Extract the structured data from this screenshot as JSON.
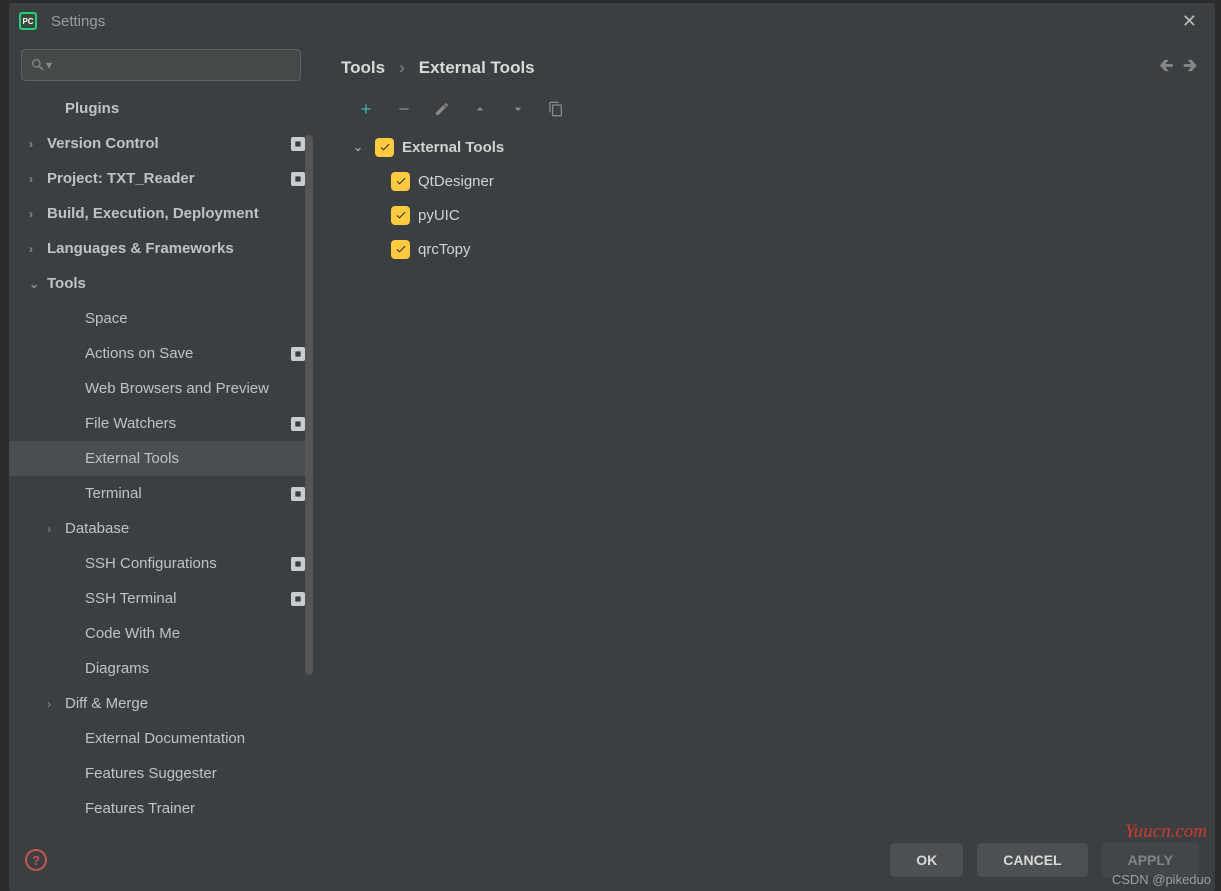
{
  "window": {
    "title": "Settings"
  },
  "search": {
    "placeholder": ""
  },
  "sidebar": {
    "items": [
      {
        "label": "Plugins",
        "arrow": "",
        "badge": false,
        "indent": 1,
        "bold": true
      },
      {
        "label": "Version Control",
        "arrow": "›",
        "badge": true,
        "indent": 0,
        "bold": true
      },
      {
        "label": "Project: TXT_Reader",
        "arrow": "›",
        "badge": true,
        "indent": 0,
        "bold": true
      },
      {
        "label": "Build, Execution, Deployment",
        "arrow": "›",
        "badge": false,
        "indent": 0,
        "bold": true
      },
      {
        "label": "Languages & Frameworks",
        "arrow": "›",
        "badge": false,
        "indent": 0,
        "bold": true
      },
      {
        "label": "Tools",
        "arrow": "⌄",
        "badge": false,
        "indent": 0,
        "bold": true
      },
      {
        "label": "Space",
        "arrow": "",
        "badge": false,
        "indent": 2,
        "bold": false
      },
      {
        "label": "Actions on Save",
        "arrow": "",
        "badge": true,
        "indent": 2,
        "bold": false
      },
      {
        "label": "Web Browsers and Preview",
        "arrow": "",
        "badge": false,
        "indent": 2,
        "bold": false
      },
      {
        "label": "File Watchers",
        "arrow": "",
        "badge": true,
        "indent": 2,
        "bold": false
      },
      {
        "label": "External Tools",
        "arrow": "",
        "badge": false,
        "indent": 2,
        "bold": false,
        "selected": true
      },
      {
        "label": "Terminal",
        "arrow": "",
        "badge": true,
        "indent": 2,
        "bold": false
      },
      {
        "label": "Database",
        "arrow": "›",
        "badge": false,
        "indent": 1,
        "bold": false
      },
      {
        "label": "SSH Configurations",
        "arrow": "",
        "badge": true,
        "indent": 2,
        "bold": false
      },
      {
        "label": "SSH Terminal",
        "arrow": "",
        "badge": true,
        "indent": 2,
        "bold": false
      },
      {
        "label": "Code With Me",
        "arrow": "",
        "badge": false,
        "indent": 2,
        "bold": false
      },
      {
        "label": "Diagrams",
        "arrow": "",
        "badge": false,
        "indent": 2,
        "bold": false
      },
      {
        "label": "Diff & Merge",
        "arrow": "›",
        "badge": false,
        "indent": 1,
        "bold": false
      },
      {
        "label": "External Documentation",
        "arrow": "",
        "badge": false,
        "indent": 2,
        "bold": false
      },
      {
        "label": "Features Suggester",
        "arrow": "",
        "badge": false,
        "indent": 2,
        "bold": false
      },
      {
        "label": "Features Trainer",
        "arrow": "",
        "badge": false,
        "indent": 2,
        "bold": false
      }
    ]
  },
  "breadcrumb": {
    "root": "Tools",
    "sep": "›",
    "leaf": "External Tools"
  },
  "tools_tree": {
    "group": "External Tools",
    "items": [
      {
        "label": "QtDesigner"
      },
      {
        "label": "pyUIC"
      },
      {
        "label": "qrcTopy"
      }
    ]
  },
  "buttons": {
    "ok": "OK",
    "cancel": "CANCEL",
    "apply": "APPLY"
  },
  "watermarks": {
    "w1": "Yuucn.com",
    "w2": "CSDN @pikeduo"
  }
}
